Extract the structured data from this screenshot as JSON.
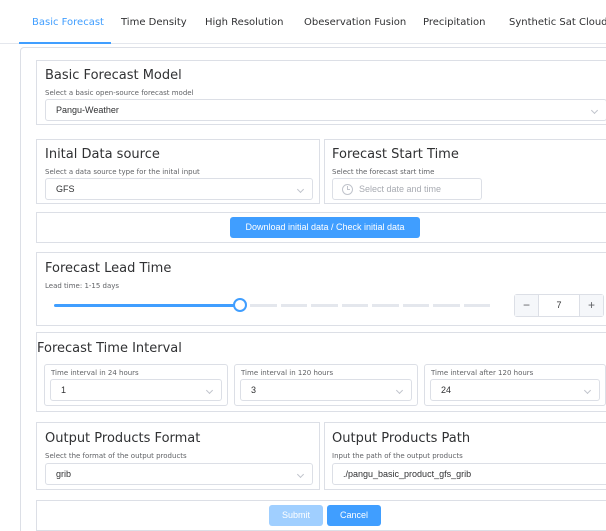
{
  "tabs": [
    {
      "label": "Basic Forecast",
      "active": true
    },
    {
      "label": "Time Density"
    },
    {
      "label": "High Resolution"
    },
    {
      "label": "Obeservation Fusion"
    },
    {
      "label": "Precipitation"
    },
    {
      "label": "Synthetic Sat Cloud"
    }
  ],
  "colors": {
    "accent": "#409eff",
    "disabled": "#a0cfff",
    "border": "#dcdfe6"
  },
  "basic_model": {
    "title": "Basic Forecast Model",
    "subtitle": "Select a basic open-source forecast model",
    "value": "Pangu-Weather",
    "icon": "chevron-down-icon"
  },
  "initial_source": {
    "title": "Inital Data source",
    "subtitle": "Select a data source type for the inital input",
    "value": "GFS",
    "icon": "chevron-down-icon"
  },
  "start_time": {
    "title": "Forecast Start Time",
    "subtitle": "Select the forecast start time",
    "placeholder": "Select date and time",
    "icon": "clock-icon"
  },
  "download": {
    "label": "Download initial data / Check initial data"
  },
  "lead_time": {
    "title": "Forecast Lead Time",
    "subtitle": "Lead time: 1-15 days",
    "value": "7",
    "min": 1,
    "max": 15,
    "minus_label": "−",
    "plus_label": "+"
  },
  "time_interval": {
    "title": "Forecast Time Interval",
    "fields": [
      {
        "label": "Time interval in 24 hours",
        "value": "1"
      },
      {
        "label": "Time interval in 120 hours",
        "value": "3"
      },
      {
        "label": "Time interval after 120 hours",
        "value": "24"
      }
    ]
  },
  "output_format": {
    "title": "Output Products Format",
    "subtitle": "Select the format of the output products",
    "value": "grib",
    "icon": "chevron-down-icon"
  },
  "output_path": {
    "title": "Output Products Path",
    "subtitle": "Input the path of the output products",
    "value": "./pangu_basic_product_gfs_grib"
  },
  "actions": {
    "submit_label": "Submit",
    "cancel_label": "Cancel",
    "submit_disabled": true
  }
}
